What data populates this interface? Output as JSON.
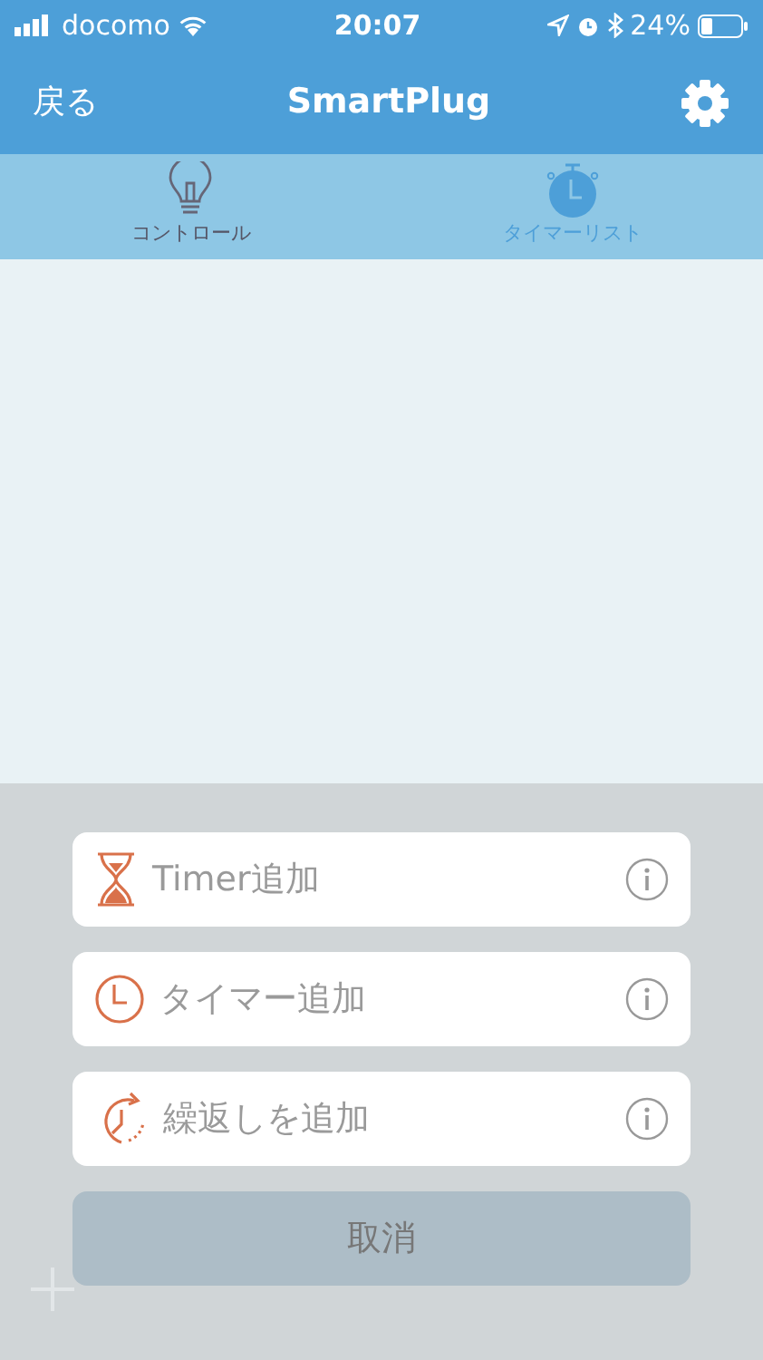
{
  "status_bar": {
    "carrier": "docomo",
    "time": "20:07",
    "battery": "24%"
  },
  "nav": {
    "back": "戻る",
    "title": "SmartPlug"
  },
  "tabs": [
    {
      "label": "コントロール",
      "kind": "bulb",
      "selected": false
    },
    {
      "label": "タイマーリスト",
      "kind": "stopwatch",
      "selected": true
    }
  ],
  "sheet": {
    "options": [
      {
        "label": "Timer追加",
        "kind": "hourglass"
      },
      {
        "label": "タイマー追加",
        "kind": "clock"
      },
      {
        "label": "繰返しを追加",
        "kind": "repeat"
      }
    ],
    "cancel": "取消"
  }
}
